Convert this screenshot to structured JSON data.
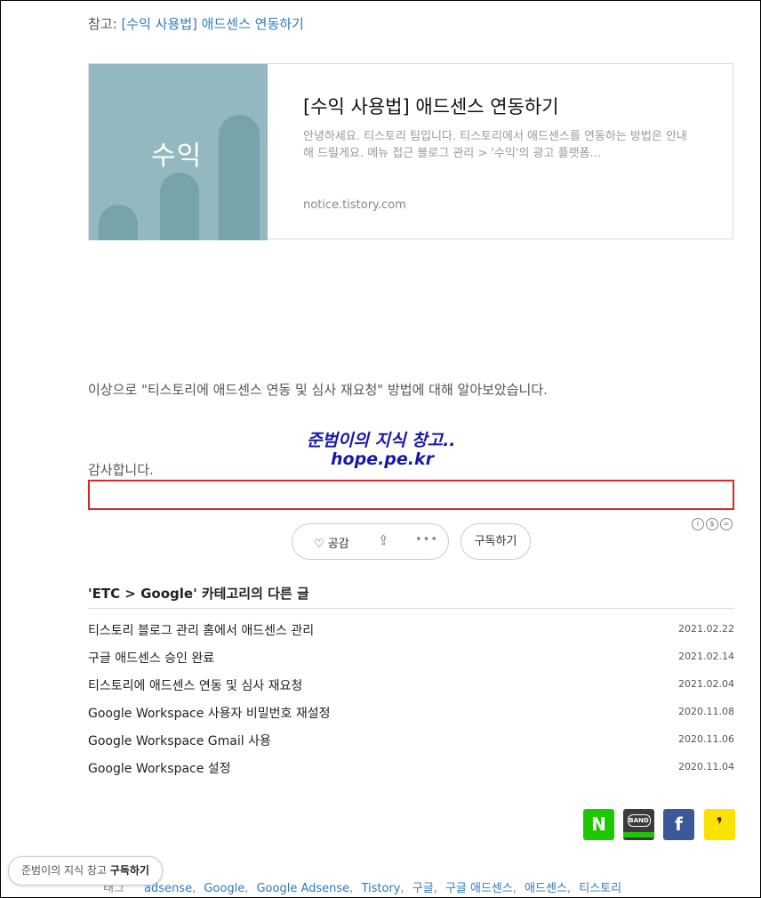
{
  "reference": {
    "prefix": "참고:",
    "link": "[수익 사용법] 애드센스 연동하기"
  },
  "card": {
    "thumb_word": "수익",
    "title": "[수익 사용법] 애드센스 연동하기",
    "desc": "안녕하세요. 티스토리 팀입니다. 티스토리에서 애드센스를 연동하는 방법은 안내해 드릴게요. 메뉴 접근 블로그 관리 > '수익'의 광고 플랫폼...",
    "host": "notice.tistory.com"
  },
  "body": {
    "summary": "이상으로 \"티스토리에 애드센스 연동 및 심사 재요청\" 방법에 대해 알아보았습니다.",
    "thanks": "감사합니다."
  },
  "watermark": {
    "line1": "준범이의 지식 창고..",
    "line2": "hope.pe.kr"
  },
  "license_icons": [
    "cc-by-icon",
    "cc-nc-icon",
    "cc-nd-icon"
  ],
  "actions": {
    "like": "공감",
    "subscribe": "구독하기"
  },
  "related": {
    "heading": "'ETC > Google' 카테고리의 다른 글",
    "posts": [
      {
        "title": "티스토리 블로그 관리 홈에서 애드센스 관리",
        "date": "2021.02.22"
      },
      {
        "title": "구글 애드센스 승인 완료",
        "date": "2021.02.14"
      },
      {
        "title": "티스토리에 애드센스 연동 및 심사 재요청",
        "date": "2021.02.04"
      },
      {
        "title": "Google Workspace 사용자 비밀번호 재설정",
        "date": "2020.11.08"
      },
      {
        "title": "Google Workspace Gmail 사용",
        "date": "2020.11.06"
      },
      {
        "title": "Google Workspace 설정",
        "date": "2020.11.04"
      }
    ]
  },
  "share": {
    "naver": "N",
    "band": "BAND",
    "facebook": "f",
    "kakao": "❜"
  },
  "tags": {
    "label": "태그",
    "items": [
      "adsense",
      "Google",
      "Google Adsense",
      "Tistory",
      "구글",
      "구글 애드센스",
      "애드센스",
      "티스토리"
    ]
  },
  "float_subscribe": {
    "blog": "준범이의 지식 창고",
    "action": "구독하기"
  },
  "colors": {
    "link": "#2e7bbf",
    "accent_red": "#d42a2a",
    "watermark": "#1818a8"
  }
}
